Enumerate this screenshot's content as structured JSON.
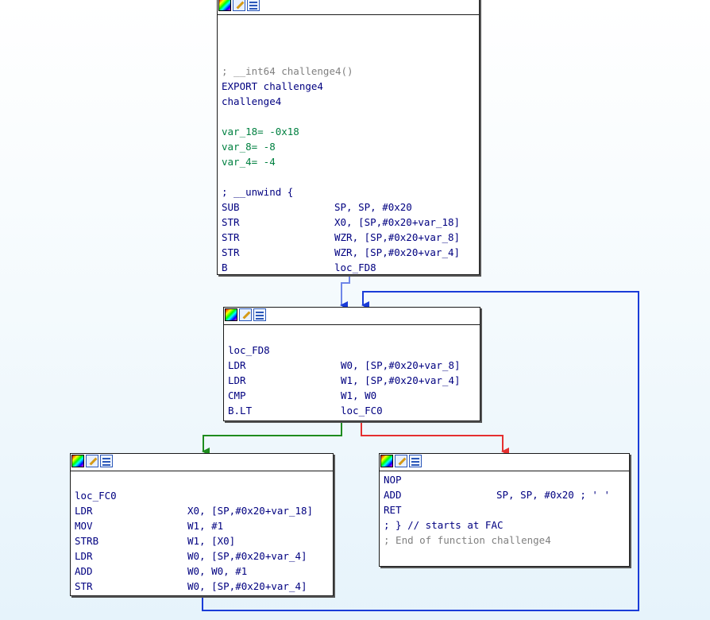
{
  "colors": {
    "edge_unconditional": "#1a3cd8",
    "edge_true": "#1e8c1e",
    "edge_false": "#e53030",
    "mnemonic": "#000080",
    "number": "#008040",
    "comment": "#808080"
  },
  "toolbar_icons": [
    "color-palette-icon",
    "edit-node-icon",
    "graph-view-icon"
  ],
  "block1": {
    "header_comment": "; __int64 challenge4()",
    "export_line": "EXPORT challenge4",
    "func_name": "challenge4",
    "vars": [
      "var_18= -0x18",
      "var_8= -8",
      "var_4= -4"
    ],
    "unwind_comment": "; __unwind {",
    "instructions": [
      {
        "mn": "SUB",
        "ops": "SP, SP, #0x20"
      },
      {
        "mn": "STR",
        "ops": "X0, [SP,#0x20+var_18]"
      },
      {
        "mn": "STR",
        "ops": "WZR, [SP,#0x20+var_8]"
      },
      {
        "mn": "STR",
        "ops": "WZR, [SP,#0x20+var_4]"
      },
      {
        "mn": "B",
        "ops": "loc_FD8"
      }
    ]
  },
  "block2": {
    "label": "loc_FD8",
    "instructions": [
      {
        "mn": "LDR",
        "ops": "W0, [SP,#0x20+var_8]"
      },
      {
        "mn": "LDR",
        "ops": "W1, [SP,#0x20+var_4]"
      },
      {
        "mn": "CMP",
        "ops": "W1, W0"
      },
      {
        "mn": "B.LT",
        "ops": "loc_FC0"
      }
    ]
  },
  "block3": {
    "label": "loc_FC0",
    "instructions": [
      {
        "mn": "LDR",
        "ops": "X0, [SP,#0x20+var_18]"
      },
      {
        "mn": "MOV",
        "ops": "W1, #1"
      },
      {
        "mn": "STRB",
        "ops": "W1, [X0]"
      },
      {
        "mn": "LDR",
        "ops": "W0, [SP,#0x20+var_4]"
      },
      {
        "mn": "ADD",
        "ops": "W0, W0, #1"
      },
      {
        "mn": "STR",
        "ops": "W0, [SP,#0x20+var_4]"
      }
    ]
  },
  "block4": {
    "instructions": [
      {
        "mn": "NOP",
        "ops": ""
      },
      {
        "mn": "ADD",
        "ops": "SP, SP, #0x20 ; ' '"
      },
      {
        "mn": "RET",
        "ops": ""
      }
    ],
    "end_comment_1": "; } // starts at FAC",
    "end_comment_2": "; End of function challenge4"
  }
}
